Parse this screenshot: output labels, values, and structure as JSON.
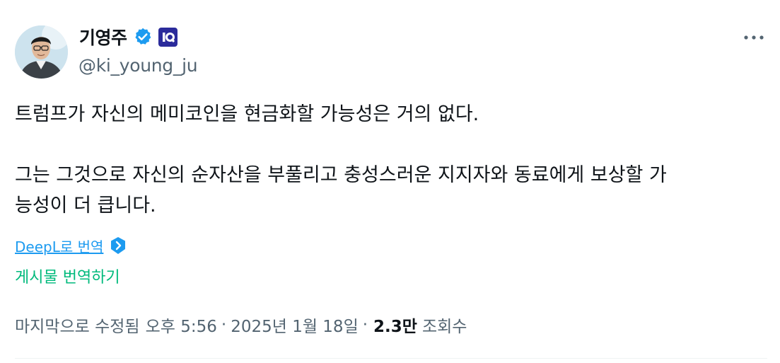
{
  "author": {
    "display_name": "기영주",
    "handle": "@ki_young_ju",
    "verified_icon": "verified-badge-icon",
    "affiliation_icon": "cryptoquant-badge-icon"
  },
  "tweet": {
    "paragraph1": "트럼프가 자신의 메미코인을 현금화할 가능성은 거의 없다.",
    "paragraph2_line1": "그는 그것으로 자신의 순자산을 부풀리고 충성스러운 지지자와 동료에게 보상할 가",
    "paragraph2_line2": "능성이 더 큽니다."
  },
  "translation": {
    "deepl_label": "DeepL로 번역",
    "translate_post_label": "게시물 번역하기"
  },
  "meta": {
    "edited_prefix": "마지막으로 수정됨",
    "time": "오후 5:56",
    "separator": "·",
    "date": "2025년 1월 18일",
    "views_count": "2.3만",
    "views_label": "조회수"
  },
  "colors": {
    "accent_blue": "#1d9bf0",
    "translate_green": "#00ba7c",
    "secondary_text": "#536471"
  }
}
